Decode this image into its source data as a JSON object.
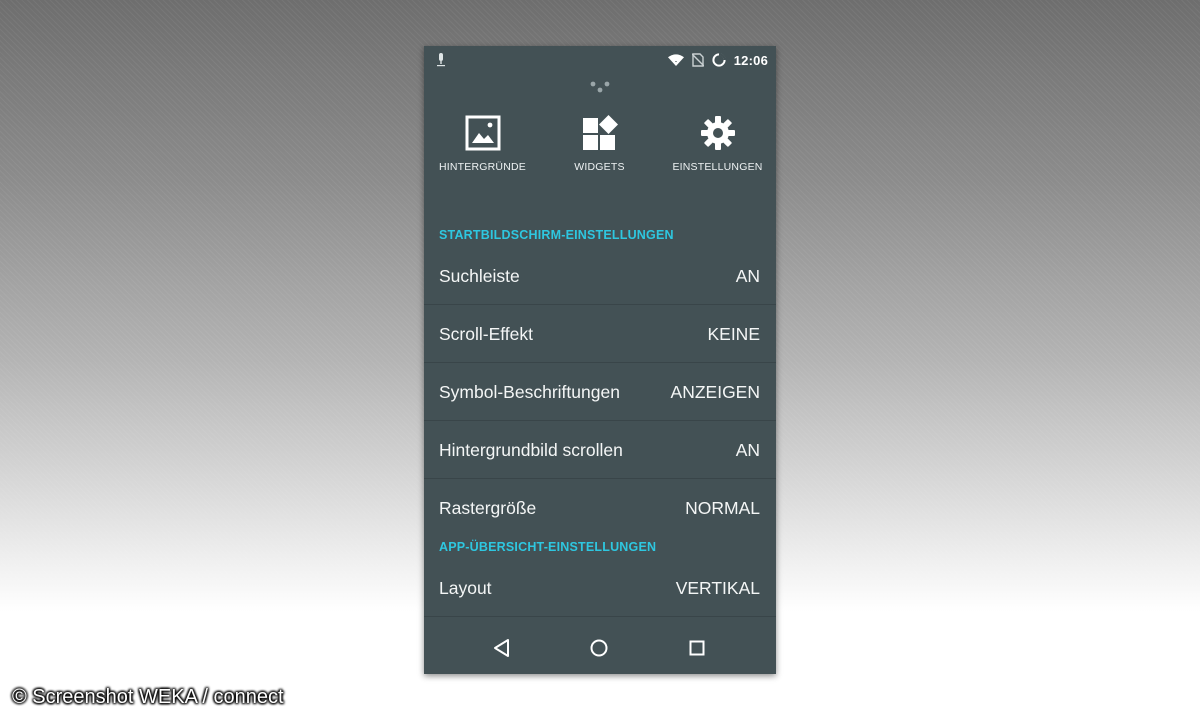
{
  "status_bar": {
    "time": "12:06",
    "icons": [
      "mic-icon",
      "wifi-icon",
      "no-sim-icon",
      "battery-circle-icon"
    ]
  },
  "quick_actions": [
    {
      "label": "HINTERGRÜNDE",
      "icon": "wallpaper-icon"
    },
    {
      "label": "WIDGETS",
      "icon": "widgets-icon"
    },
    {
      "label": "EINSTELLUNGEN",
      "icon": "gear-icon"
    }
  ],
  "home_settings": {
    "header": "STARTBILDSCHIRM-EINSTELLUNGEN",
    "items": [
      {
        "label": "Suchleiste",
        "value": "AN"
      },
      {
        "label": "Scroll-Effekt",
        "value": "KEINE"
      },
      {
        "label": "Symbol-Beschriftungen",
        "value": "ANZEIGEN"
      },
      {
        "label": "Hintergrundbild scrollen",
        "value": "AN"
      },
      {
        "label": "Rastergröße",
        "value": "NORMAL"
      }
    ]
  },
  "app_drawer_settings": {
    "header": "APP-ÜBERSICHT-EINSTELLUNGEN",
    "items": [
      {
        "label": "Layout",
        "value": "VERTIKAL"
      }
    ]
  },
  "nav_bar": {
    "buttons": [
      "back-icon",
      "home-icon",
      "recents-icon"
    ]
  },
  "watermark": "© Screenshot WEKA / connect",
  "colors": {
    "panel_background": "#435155",
    "section_header": "#2ec7e0",
    "text": "#ffffff"
  }
}
